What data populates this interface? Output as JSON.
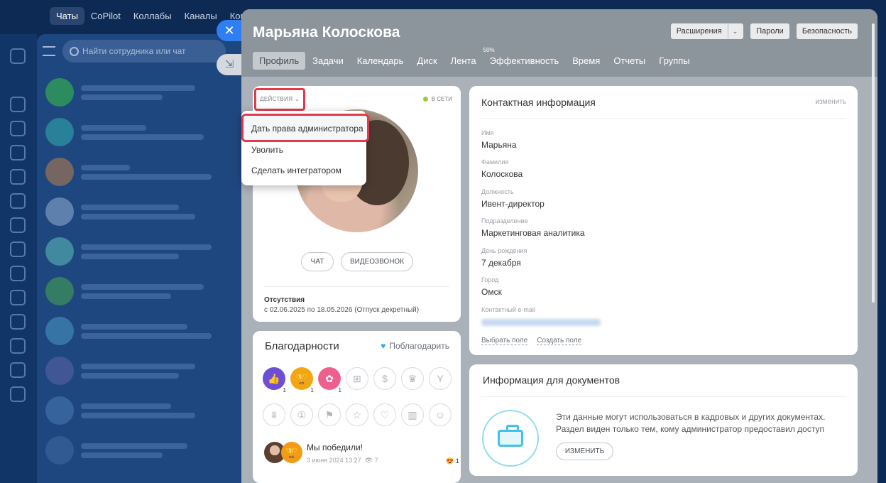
{
  "messenger": {
    "nav": [
      "Чаты",
      "CoPilot",
      "Коллабы",
      "Каналы",
      "Конт"
    ],
    "search_placeholder": "Найти сотрудника или чат"
  },
  "slider": {
    "title": "Марьяна Колоскова",
    "buttons": {
      "extensions": "Расширения",
      "passwords": "Пароли",
      "security": "Безопасность"
    },
    "tabs": [
      {
        "label": "Профиль",
        "active": true
      },
      {
        "label": "Задачи"
      },
      {
        "label": "Календарь"
      },
      {
        "label": "Диск"
      },
      {
        "label": "Лента"
      },
      {
        "label": "Эффективность",
        "badge": "50%"
      },
      {
        "label": "Время"
      },
      {
        "label": "Отчеты"
      },
      {
        "label": "Группы"
      }
    ]
  },
  "profile": {
    "actions_label": "ДЕЙСТВИЯ",
    "status": "В СЕТИ",
    "chat_btn": "ЧАТ",
    "video_btn": "ВИДЕОЗВОНОК",
    "absence_title": "Отсутствия",
    "absence_text": "с 02.06.2025 по 18.05.2026 (Отпуск декретный)"
  },
  "actions_menu": [
    "Дать права администратора",
    "Уволить",
    "Сделать интегратором"
  ],
  "thanks": {
    "title": "Благодарности",
    "thank_btn": "Поблагодарить",
    "badge_counts": [
      "1",
      "1",
      "1"
    ],
    "post": {
      "title": "Мы победили!",
      "date": "3 июня 2024 13:27",
      "views": "7",
      "reactions": "1"
    }
  },
  "contact": {
    "title": "Контактная информация",
    "edit": "изменить",
    "fields": [
      {
        "label": "Имя",
        "value": "Марьяна"
      },
      {
        "label": "Фамилия",
        "value": "Колоскова"
      },
      {
        "label": "Должность",
        "value": "Ивент-директор"
      },
      {
        "label": "Подразделение",
        "value": "Маркетинговая аналитика"
      },
      {
        "label": "День рождения",
        "value": "7 декабря"
      },
      {
        "label": "Город",
        "value": "Омск"
      },
      {
        "label": "Контактный e-mail",
        "value": ""
      }
    ],
    "choose_field": "Выбрать поле",
    "create_field": "Создать поле"
  },
  "docs": {
    "title": "Информация для документов",
    "line1": "Эти данные могут использоваться в кадровых и других документах.",
    "line2": "Раздел виден только тем, кому администратор предоставил доступ",
    "button": "ИЗМЕНИТЬ"
  },
  "colors": {
    "highlight": "#e23a4a",
    "online": "#9acd32",
    "primary": "#2f7ff2"
  }
}
